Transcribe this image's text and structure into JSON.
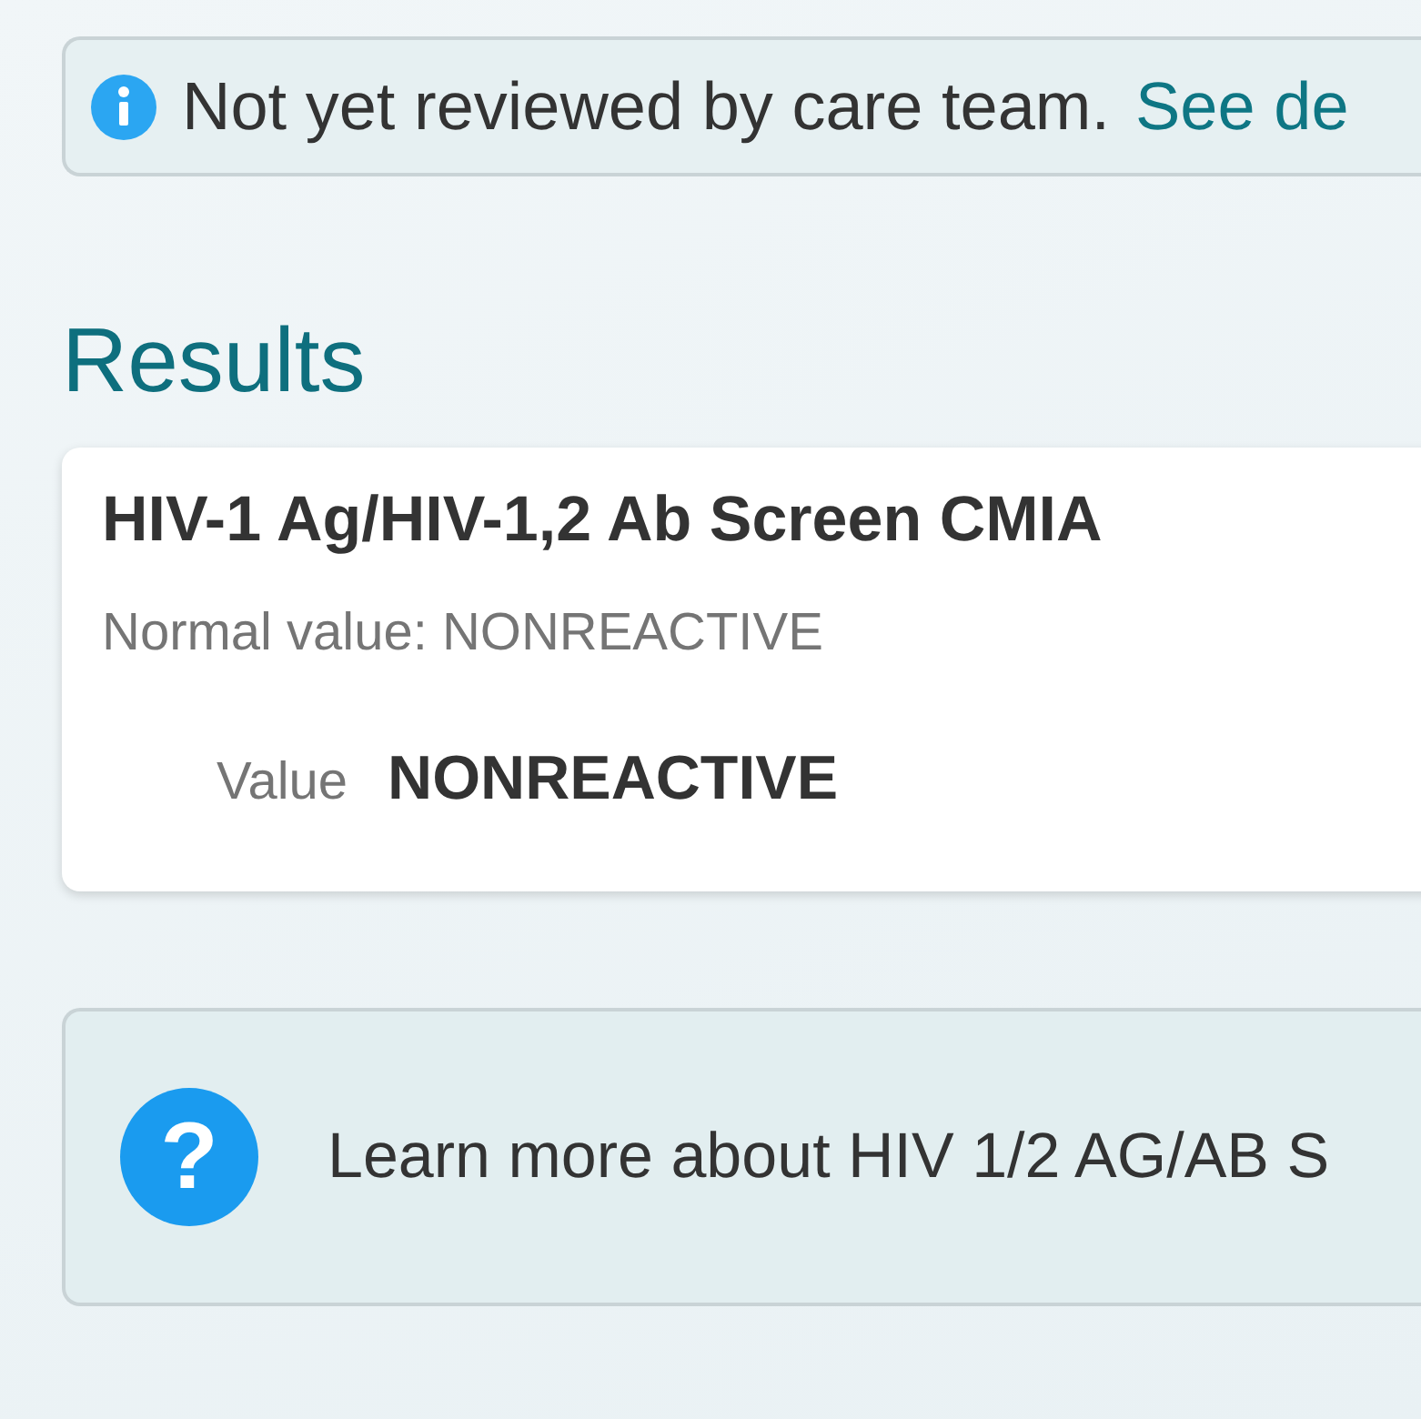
{
  "review_banner": {
    "message": "Not yet reviewed by care team.",
    "link": "See de"
  },
  "results": {
    "heading": "Results",
    "tests": [
      {
        "name": "HIV-1 Ag/HIV-1,2 Ab Screen CMIA",
        "normal_value": "Normal value: NONREACTIVE",
        "value_label": "Value",
        "value": "NONREACTIVE"
      }
    ]
  },
  "learn_more": {
    "icon": "?",
    "text": "Learn more about HIV 1/2 AG/AB S"
  }
}
